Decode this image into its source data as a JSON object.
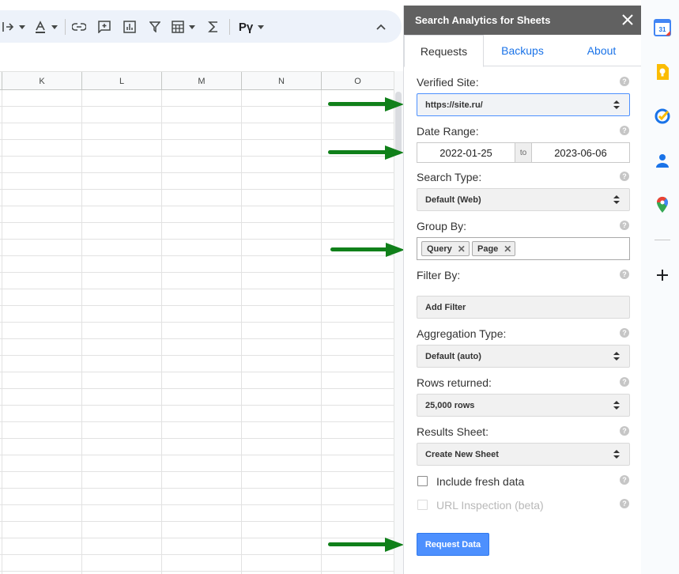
{
  "toolbar": {
    "currency_label": "Рү",
    "icons": [
      "vertical-align-icon",
      "text-color-icon",
      "link-icon",
      "comment-icon",
      "chart-icon",
      "filter-icon",
      "table-icon",
      "functions-icon",
      "collapse-icon"
    ]
  },
  "grid": {
    "columns": [
      "K",
      "L",
      "M",
      "N",
      "O"
    ]
  },
  "sidebar": {
    "title": "Search Analytics for Sheets",
    "tabs": [
      "Requests",
      "Backups",
      "About"
    ],
    "active_tab": "Requests",
    "verified_site": {
      "label": "Verified Site:",
      "value": "https://site.ru/"
    },
    "date_range": {
      "label": "Date Range:",
      "start": "2022-01-25",
      "separator": "to",
      "end": "2023-06-06"
    },
    "search_type": {
      "label": "Search Type:",
      "value": "Default (Web)"
    },
    "group_by": {
      "label": "Group By:",
      "chips": [
        "Query",
        "Page"
      ]
    },
    "filter_by": {
      "label": "Filter By:",
      "button": "Add Filter"
    },
    "aggregation_type": {
      "label": "Aggregation Type:",
      "value": "Default (auto)"
    },
    "rows_returned": {
      "label": "Rows returned:",
      "value": "25,000 rows"
    },
    "results_sheet": {
      "label": "Results Sheet:",
      "value": "Create New Sheet"
    },
    "include_fresh_data": {
      "label": "Include fresh data",
      "checked": false
    },
    "url_inspection": {
      "label": "URL Inspection (beta)",
      "checked": false,
      "disabled": true
    },
    "request_button": "Request Data",
    "help_glyph": "?"
  },
  "rail": {
    "icons": [
      "calendar-icon",
      "keep-icon",
      "tasks-icon",
      "contacts-icon",
      "maps-icon",
      "add-icon"
    ],
    "calendar_day": "31"
  },
  "colors": {
    "arrow": "#10801a",
    "primary_button": "#4d90fe",
    "link": "#1a73e8",
    "panel_header": "#616161"
  }
}
